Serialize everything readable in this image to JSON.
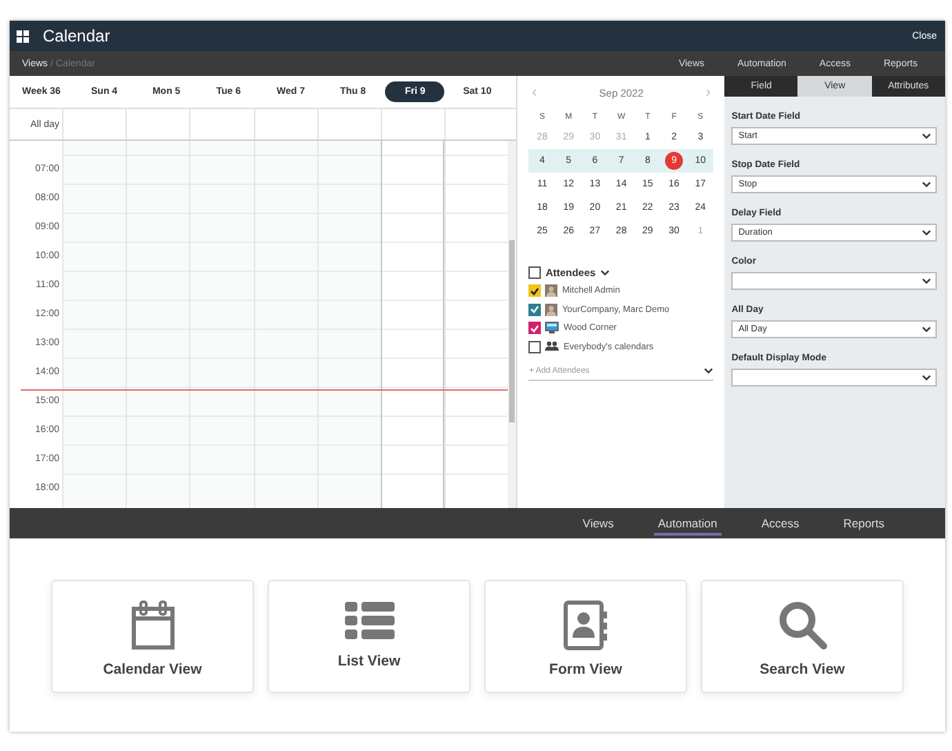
{
  "window": {
    "title": "Calendar",
    "close_label": "Close"
  },
  "breadcrumb": {
    "parent": "Views",
    "separator": "/",
    "current": "Calendar"
  },
  "top_nav": [
    {
      "label": "Views"
    },
    {
      "label": "Automation"
    },
    {
      "label": "Access"
    },
    {
      "label": "Reports"
    }
  ],
  "week_header": {
    "week_label": "Week 36",
    "days": [
      {
        "label": "Sun 4",
        "selected": false
      },
      {
        "label": "Mon 5",
        "selected": false
      },
      {
        "label": "Tue 6",
        "selected": false
      },
      {
        "label": "Wed 7",
        "selected": false
      },
      {
        "label": "Thu 8",
        "selected": false
      },
      {
        "label": "Fri 9",
        "selected": true
      },
      {
        "label": "Sat 10",
        "selected": false
      }
    ]
  },
  "all_day_label": "All day",
  "hours": [
    "07:00",
    "08:00",
    "09:00",
    "10:00",
    "11:00",
    "12:00",
    "13:00",
    "14:00",
    "15:00",
    "16:00",
    "17:00",
    "18:00"
  ],
  "mini_calendar": {
    "prev": "‹",
    "next": "›",
    "month_label": "Sep 2022",
    "weekdays": [
      "S",
      "M",
      "T",
      "W",
      "T",
      "F",
      "S"
    ],
    "weeks": [
      {
        "selected": false,
        "days": [
          {
            "label": "28",
            "outside_month": true,
            "today": false
          },
          {
            "label": "29",
            "outside_month": true,
            "today": false
          },
          {
            "label": "30",
            "outside_month": true,
            "today": false
          },
          {
            "label": "31",
            "outside_month": true,
            "today": false
          },
          {
            "label": "1",
            "outside_month": false,
            "today": false
          },
          {
            "label": "2",
            "outside_month": false,
            "today": false
          },
          {
            "label": "3",
            "outside_month": false,
            "today": false
          }
        ]
      },
      {
        "selected": true,
        "days": [
          {
            "label": "4",
            "outside_month": false,
            "today": false
          },
          {
            "label": "5",
            "outside_month": false,
            "today": false
          },
          {
            "label": "6",
            "outside_month": false,
            "today": false
          },
          {
            "label": "7",
            "outside_month": false,
            "today": false
          },
          {
            "label": "8",
            "outside_month": false,
            "today": false
          },
          {
            "label": "9",
            "outside_month": false,
            "today": true
          },
          {
            "label": "10",
            "outside_month": false,
            "today": false
          }
        ]
      },
      {
        "selected": false,
        "days": [
          {
            "label": "11",
            "outside_month": false,
            "today": false
          },
          {
            "label": "12",
            "outside_month": false,
            "today": false
          },
          {
            "label": "13",
            "outside_month": false,
            "today": false
          },
          {
            "label": "14",
            "outside_month": false,
            "today": false
          },
          {
            "label": "15",
            "outside_month": false,
            "today": false
          },
          {
            "label": "16",
            "outside_month": false,
            "today": false
          },
          {
            "label": "17",
            "outside_month": false,
            "today": false
          }
        ]
      },
      {
        "selected": false,
        "days": [
          {
            "label": "18",
            "outside_month": false,
            "today": false
          },
          {
            "label": "19",
            "outside_month": false,
            "today": false
          },
          {
            "label": "20",
            "outside_month": false,
            "today": false
          },
          {
            "label": "21",
            "outside_month": false,
            "today": false
          },
          {
            "label": "22",
            "outside_month": false,
            "today": false
          },
          {
            "label": "23",
            "outside_month": false,
            "today": false
          },
          {
            "label": "24",
            "outside_month": false,
            "today": false
          }
        ]
      },
      {
        "selected": false,
        "days": [
          {
            "label": "25",
            "outside_month": false,
            "today": false
          },
          {
            "label": "26",
            "outside_month": false,
            "today": false
          },
          {
            "label": "27",
            "outside_month": false,
            "today": false
          },
          {
            "label": "28",
            "outside_month": false,
            "today": false
          },
          {
            "label": "29",
            "outside_month": false,
            "today": false
          },
          {
            "label": "30",
            "outside_month": false,
            "today": false
          },
          {
            "label": "1",
            "outside_month": true,
            "today": false
          }
        ]
      }
    ]
  },
  "attendees": {
    "label": "Attendees",
    "checked": false,
    "add_placeholder": "+ Add Attendees",
    "items": [
      {
        "name": "Mitchell Admin",
        "kind": "avatar",
        "checked": true,
        "color": "#f2c318"
      },
      {
        "name": "YourCompany, Marc Demo",
        "kind": "avatar",
        "checked": true,
        "color": "#2b7e8e"
      },
      {
        "name": "Wood Corner",
        "kind": "screen",
        "checked": true,
        "color": "#d4206c"
      },
      {
        "name": "Everybody's calendars",
        "kind": "group",
        "checked": false
      }
    ]
  },
  "properties": {
    "tabs": [
      {
        "label": "Field",
        "selected": false
      },
      {
        "label": "View",
        "selected": true
      },
      {
        "label": "Attributes",
        "selected": false
      }
    ],
    "fields": [
      {
        "label": "Start Date Field",
        "value": "Start"
      },
      {
        "label": "Stop Date Field",
        "value": "Stop"
      },
      {
        "label": "Delay Field",
        "value": "Duration"
      },
      {
        "label": "Color"
      },
      {
        "label": "All Day",
        "value": "All Day"
      },
      {
        "label": "Default Display Mode"
      }
    ]
  },
  "bottom_nav": [
    {
      "label": "Views",
      "selected": false
    },
    {
      "label": "Automation",
      "selected": true
    },
    {
      "label": "Access",
      "selected": false
    },
    {
      "label": "Reports",
      "selected": false
    }
  ],
  "view_cards": [
    {
      "label": "Calendar View",
      "kind": "calendar"
    },
    {
      "label": "List View",
      "kind": "list"
    },
    {
      "label": "Form View",
      "kind": "form"
    },
    {
      "label": "Search View",
      "kind": "search"
    }
  ]
}
